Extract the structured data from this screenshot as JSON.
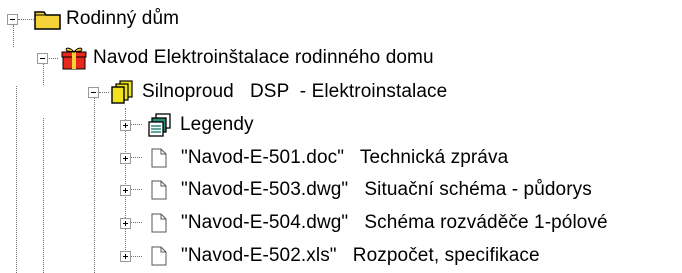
{
  "tree": {
    "root": {
      "label": "Rodinný dům",
      "icon": "folder-icon",
      "expanded": true
    },
    "project": {
      "label": "Navod Elektroinštalace rodinného domu",
      "icon": "gift-icon",
      "expanded": true
    },
    "group": {
      "label": "Silnoproud   DSP  - Elektroinstalace",
      "icon": "yellow-documents-icon",
      "expanded": true
    },
    "items": [
      {
        "label": "Legendy",
        "icon": "stacked-pages-icon"
      },
      {
        "label": "\"Navod-E-501.doc\"   Technická zpráva",
        "icon": "document-icon"
      },
      {
        "label": "\"Navod-E-503.dwg\"   Situační schéma - půdorys",
        "icon": "document-icon"
      },
      {
        "label": "\"Navod-E-504.dwg\"   Schéma rozváděče 1-pólové",
        "icon": "document-icon"
      },
      {
        "label": "\"Navod-E-502.xls\"   Rozpočet, specifikace",
        "icon": "document-icon"
      }
    ]
  },
  "colors": {
    "folder": "#f5d238",
    "gift": "#e8271d",
    "docs": "#f0e21c",
    "legend": "#2a8a7a",
    "lines": "#6e6e6e"
  }
}
